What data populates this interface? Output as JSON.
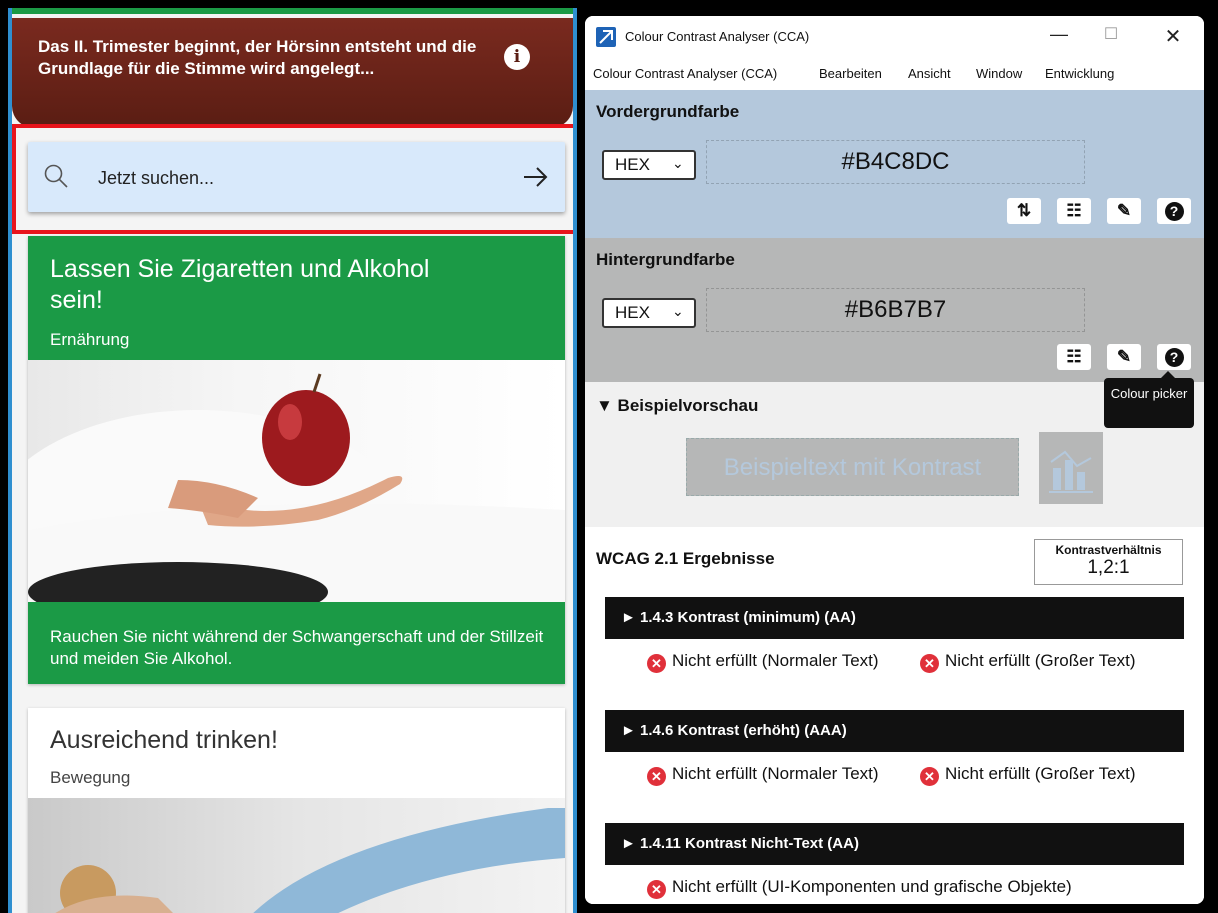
{
  "app": {
    "banner_text": "Das II. Trimester beginnt, der Hörsinn entsteht und die Grundlage für die Stimme wird angelegt...",
    "search_placeholder": "Jetzt suchen...",
    "card1": {
      "title": "Lassen Sie Zigaretten und Alkohol sein!",
      "category": "Ernährung",
      "description": "Rauchen Sie nicht während der Schwangerschaft und der Stillzeit und meiden Sie Alkohol."
    },
    "card2": {
      "title": "Ausreichend trinken!",
      "category": "Bewegung"
    }
  },
  "cca": {
    "window_title": "Colour Contrast Analyser (CCA)",
    "menu": [
      "Colour Contrast Analyser (CCA)",
      "Bearbeiten",
      "Ansicht",
      "Window",
      "Entwicklung"
    ],
    "foreground": {
      "title": "Vordergrundfarbe",
      "format": "HEX",
      "value": "#B4C8DC"
    },
    "background": {
      "title": "Hintergrundfarbe",
      "format": "HEX",
      "value": "#B6B7B7"
    },
    "tooltip": "Colour picker",
    "preview": {
      "title": "▼ Beispielvorschau",
      "sample_text": "Beispieltext mit Kontrast"
    },
    "results": {
      "title": "WCAG 2.1 Ergebnisse",
      "ratio_label": "Kontrastverhältnis",
      "ratio_value": "1,2:1",
      "criteria": [
        {
          "label": "► 1.4.3 Kontrast (minimum) (AA)",
          "result_a": "Nicht erfüllt (Normaler Text)",
          "result_b": "Nicht erfüllt (Großer Text)"
        },
        {
          "label": "► 1.4.6 Kontrast (erhöht) (AAA)",
          "result_a": "Nicht erfüllt (Normaler Text)",
          "result_b": "Nicht erfüllt (Großer Text)"
        },
        {
          "label": "► 1.4.11 Kontrast Nicht-Text (AA)",
          "result_a": "Nicht erfüllt (UI-Komponenten und grafische Objekte)"
        }
      ]
    }
  },
  "colors": {
    "foreground": "#B4C8DC",
    "background": "#B6B7B7",
    "app_green": "#1b9a46",
    "highlight_red": "#e8141c"
  }
}
